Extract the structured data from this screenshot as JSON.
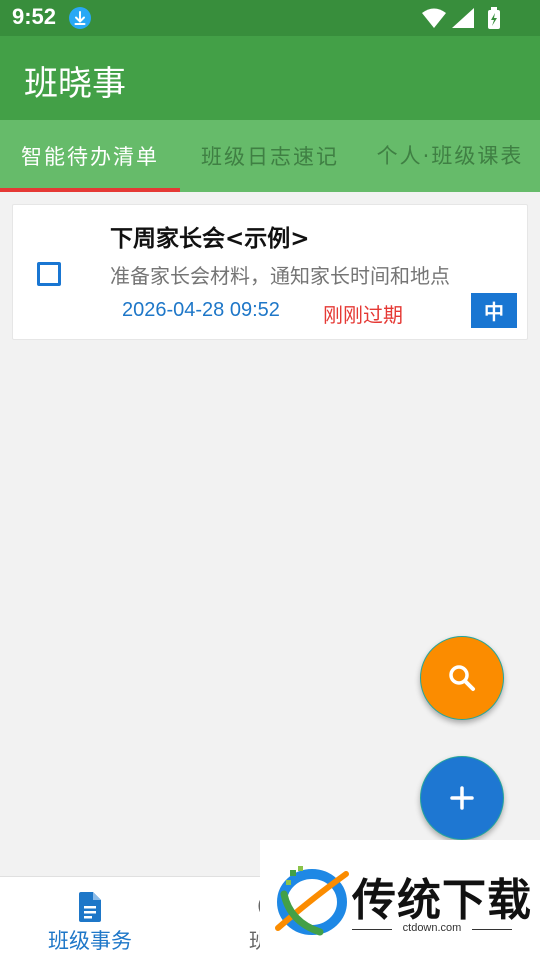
{
  "status_bar": {
    "time": "9:52"
  },
  "app": {
    "title": "班晓事"
  },
  "tabs": [
    {
      "label": "智能待办清单",
      "active": true
    },
    {
      "label": "班级日志速记",
      "active": false
    },
    {
      "label": "个人·班级课表",
      "active": false
    }
  ],
  "tasks": [
    {
      "title": "下周家长会<示例>",
      "description": "准备家长会材料，通知家长时间和地点",
      "datetime": "2026-04-28 09:52",
      "status": "刚刚过期",
      "priority": "中",
      "checked": false
    }
  ],
  "bottom_nav": [
    {
      "label": "班级事务",
      "icon": "document-icon",
      "active": true
    },
    {
      "label": "班级",
      "icon": "clock-icon",
      "active": false
    }
  ],
  "watermark": {
    "text": "传统下载",
    "subtext": "ctdown.com"
  },
  "colors": {
    "status_bar": "#388e3c",
    "app_bar": "#43a047",
    "tab_bar": "#66bb6a",
    "tab_indicator": "#e53935",
    "accent_blue": "#1976d2",
    "fab_search": "#fb8c00",
    "expired_red": "#e53935"
  }
}
